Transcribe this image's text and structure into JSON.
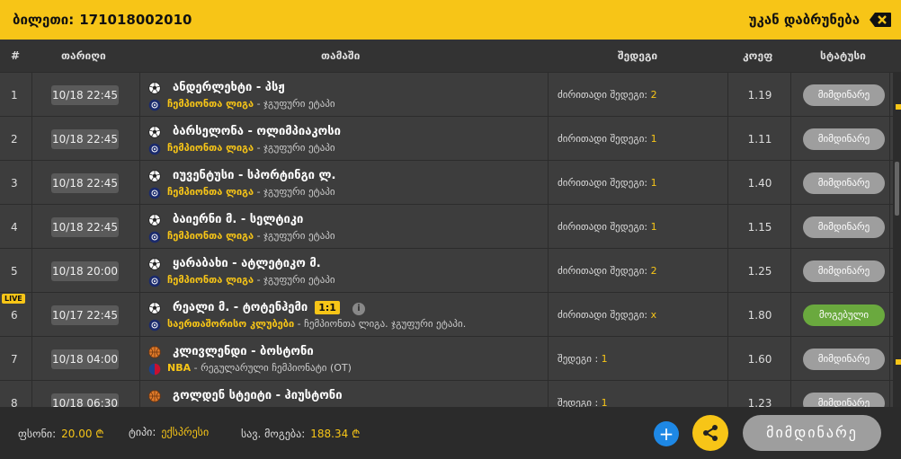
{
  "header": {
    "ticket_label": "ბილეთი:",
    "ticket_number": "171018002010",
    "back_label": "უკან დაბრუნება"
  },
  "columns": {
    "num": "#",
    "date": "თარიღი",
    "game": "თამაში",
    "bet": "შედეგი",
    "odd": "კოეფ",
    "status": "სტატუსი"
  },
  "rows": [
    {
      "num": "1",
      "date": "10/18 22:45",
      "sport": "soccer-ball-icon",
      "teams": "ანდერლეხტი - პსჟ",
      "league_main": "ჩემპიონთა ლიგა",
      "league_sub": "- ჯგუფური ეტაპი",
      "bet_label": "ძირითადი შედეგი:",
      "bet_value": "2",
      "odd": "1.19",
      "status": "მიმდინარე"
    },
    {
      "num": "2",
      "date": "10/18 22:45",
      "sport": "soccer-ball-icon",
      "teams": "ბარსელონა - ოლიმპიაკოსი",
      "league_main": "ჩემპიონთა ლიგა",
      "league_sub": "- ჯგუფური ეტაპი",
      "bet_label": "ძირითადი შედეგი:",
      "bet_value": "1",
      "odd": "1.11",
      "status": "მიმდინარე"
    },
    {
      "num": "3",
      "date": "10/18 22:45",
      "sport": "soccer-ball-icon",
      "teams": "იუვენტუსი - სპორტინგი ლ.",
      "league_main": "ჩემპიონთა ლიგა",
      "league_sub": "- ჯგუფური ეტაპი",
      "bet_label": "ძირითადი შედეგი:",
      "bet_value": "1",
      "odd": "1.40",
      "status": "მიმდინარე"
    },
    {
      "num": "4",
      "date": "10/18 22:45",
      "sport": "soccer-ball-icon",
      "teams": "ბაიერნი მ. - სელტიკი",
      "league_main": "ჩემპიონთა ლიგა",
      "league_sub": "- ჯგუფური ეტაპი",
      "bet_label": "ძირითადი შედეგი:",
      "bet_value": "1",
      "odd": "1.15",
      "status": "მიმდინარე"
    },
    {
      "num": "5",
      "date": "10/18 20:00",
      "sport": "soccer-ball-icon",
      "teams": "ყარაბახი - ატლეტიკო მ.",
      "league_main": "ჩემპიონთა ლიგა",
      "league_sub": "- ჯგუფური ეტაპი",
      "bet_label": "ძირითადი შედეგი:",
      "bet_value": "2",
      "odd": "1.25",
      "status": "მიმდინარე"
    },
    {
      "num": "6",
      "live": "LIVE",
      "date": "10/17 22:45",
      "sport": "soccer-ball-icon",
      "teams": "რეალი მ. - ტოტენჰემი",
      "score": "1:1",
      "league_main": "საერთაშორისო კლუბები",
      "league_sub": "- ჩემპიონთა ლიგა. ჯგუფური ეტაპი.",
      "bet_label": "ძირითადი შედეგი:",
      "bet_value": "x",
      "odd": "1.80",
      "status": "მოგებული",
      "won": true
    },
    {
      "num": "7",
      "date": "10/18 04:00",
      "sport": "basketball-icon",
      "teams": "კლივლენდი - ბოსტონი",
      "league_main": "NBA",
      "league_sub": "- რეგულარული ჩემპიონატი (OT)",
      "bet_label": "შედეგი :",
      "bet_value": "1",
      "odd": "1.60",
      "status": "მიმდინარე"
    },
    {
      "num": "8",
      "date": "10/18 06:30",
      "sport": "basketball-icon",
      "teams": "გოლდენ სტეიტი - ჰიუსტონი",
      "league_main": "",
      "league_sub": "",
      "bet_label": "შედეგი :",
      "bet_value": "1",
      "odd": "1.23",
      "status": "მიმდინარე"
    }
  ],
  "footer": {
    "stake_label": "ფსონი:",
    "stake_value": "20.00 ₾",
    "type_label": "ტიპი:",
    "type_value": "ექსპრესი",
    "win_label": "სავ. მოგება:",
    "win_value": "188.34 ₾",
    "plus_label": "+",
    "main_button": "მიმდინარე"
  },
  "colors": {
    "accent": "#f7c517",
    "won": "#6aa93e",
    "pending": "#9e9e9e",
    "plus": "#1e88e5"
  }
}
